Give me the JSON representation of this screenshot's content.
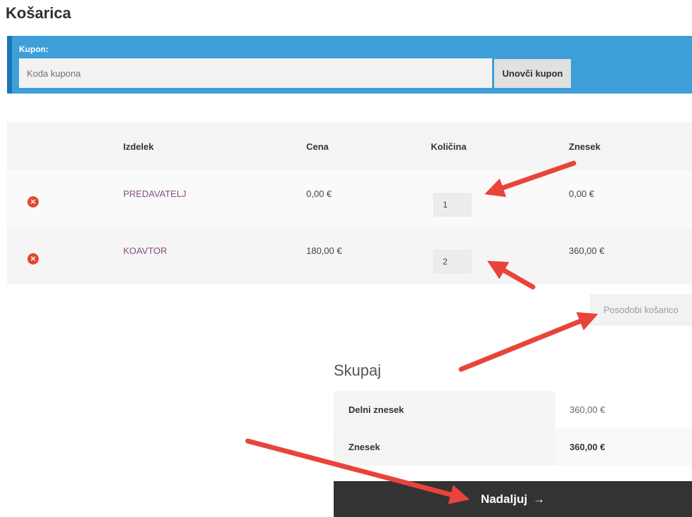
{
  "page": {
    "title": "Košarica"
  },
  "coupon": {
    "label": "Kupon:",
    "placeholder": "Koda kupona",
    "value": "",
    "button_label": "Unovči kupon"
  },
  "cart": {
    "headers": {
      "product": "Izdelek",
      "price": "Cena",
      "quantity": "Količina",
      "total": "Znesek"
    },
    "items": [
      {
        "name": "PREDAVATELJ",
        "price": "0,00 €",
        "quantity": "1",
        "total": "0,00 €"
      },
      {
        "name": "KOAVTOR",
        "price": "180,00 €",
        "quantity": "2",
        "total": "360,00 €"
      }
    ],
    "remove_icon": "remove-circle-x-icon",
    "update_button_label": "Posodobi košarico"
  },
  "totals": {
    "title": "Skupaj",
    "subtotal_label": "Delni znesek",
    "subtotal_value": "360,00 €",
    "total_label": "Znesek",
    "total_value": "360,00 €"
  },
  "checkout": {
    "button_label": "Nadaljuj",
    "arrow": "→"
  },
  "colors": {
    "coupon_bar": "#3e9fd8",
    "coupon_bar_accent": "#1b73b8",
    "remove_icon": "#e0492f",
    "product_link": "#8a4f86",
    "checkout_button": "#333333",
    "annotation_arrow": "#e8443a"
  }
}
